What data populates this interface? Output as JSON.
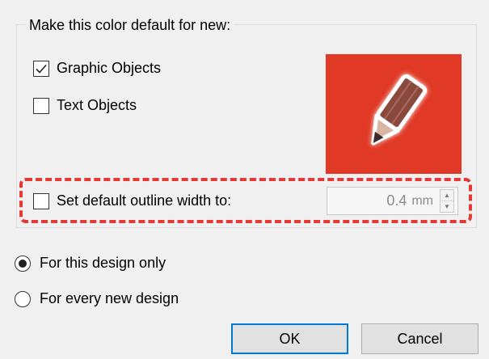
{
  "group": {
    "title": "Make this color default for new:"
  },
  "options": {
    "graphic_objects": {
      "label": "Graphic Objects",
      "checked": true
    },
    "text_objects": {
      "label": "Text Objects",
      "checked": false
    },
    "outline_width": {
      "label": "Set default outline width to:",
      "checked": false,
      "value": "0.4",
      "unit": "mm"
    }
  },
  "preview": {
    "icon": "pencil-icon",
    "background": "#e03a26"
  },
  "scope": {
    "this_design": {
      "label": "For this design only",
      "selected": true
    },
    "every_design": {
      "label": "For every new design",
      "selected": false
    }
  },
  "buttons": {
    "ok": "OK",
    "cancel": "Cancel"
  },
  "colors": {
    "highlight": "#e53935",
    "accent": "#0078d7"
  }
}
